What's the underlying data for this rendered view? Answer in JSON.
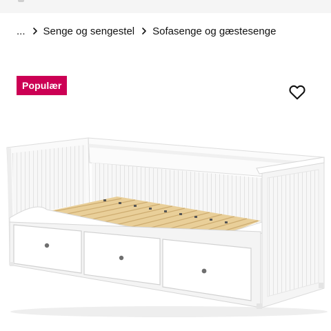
{
  "breadcrumb": {
    "items": [
      {
        "label": "..."
      },
      {
        "label": "Senge og sengestel"
      },
      {
        "label": "Sofasenge og gæstesenge"
      }
    ]
  },
  "product": {
    "badge": "Populær",
    "image_alt": "Daybed with 3 drawers"
  },
  "icons": {
    "favourite": "heart-outline-icon",
    "separator": "chevron-right-icon"
  },
  "colors": {
    "badge_bg": "#cc0054",
    "badge_text": "#ffffff",
    "text": "#111111"
  }
}
